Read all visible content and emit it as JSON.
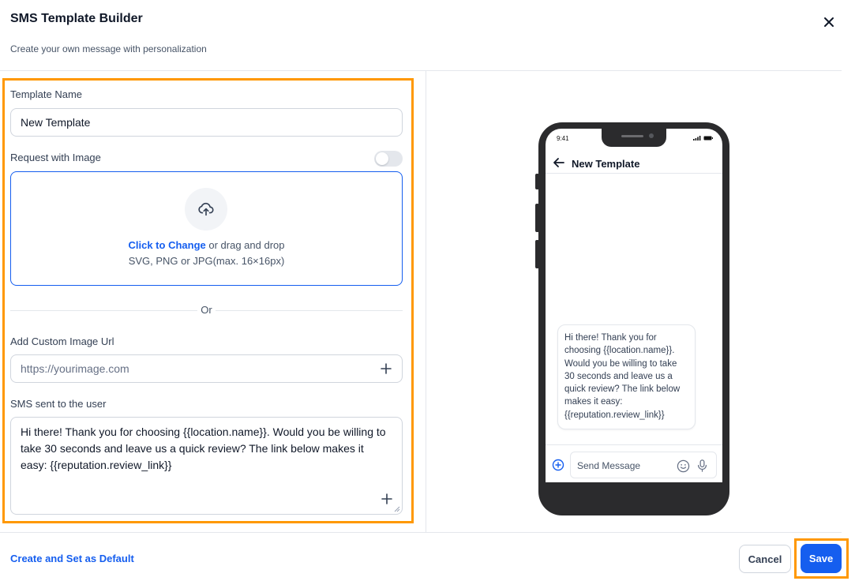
{
  "header": {
    "title": "SMS Template Builder",
    "subtitle": "Create your own message with personalization"
  },
  "form": {
    "template_name_label": "Template Name",
    "template_name_value": "New Template",
    "request_image_label": "Request with Image",
    "request_image_enabled": false,
    "upload": {
      "link_text": "Click to Change",
      "rest_text": " or drag and drop",
      "hint": "SVG, PNG or JPG(max. 16×16px)"
    },
    "divider_text": "Or",
    "custom_url_label": "Add Custom Image Url",
    "custom_url_placeholder": "https://yourimage.com",
    "sms_label": "SMS sent to the user",
    "sms_text": "Hi there! Thank you for choosing {{location.name}}. Would you be willing to take 30 seconds and leave us a quick review? The link below makes it easy: {{reputation.review_link}}"
  },
  "preview": {
    "status_time": "9:41",
    "title": "New Template",
    "message": "Hi there! Thank you for choosing {{location.name}}. Would you be willing to take 30 seconds and leave us a quick review? The link below makes it easy: {{reputation.review_link}}",
    "compose_placeholder": "Send Message"
  },
  "footer": {
    "default_link": "Create and Set as Default",
    "cancel_label": "Cancel",
    "save_label": "Save"
  },
  "colors": {
    "accent": "#155eef",
    "highlight": "#ff9800",
    "phone_frame": "#2b2b2d"
  }
}
